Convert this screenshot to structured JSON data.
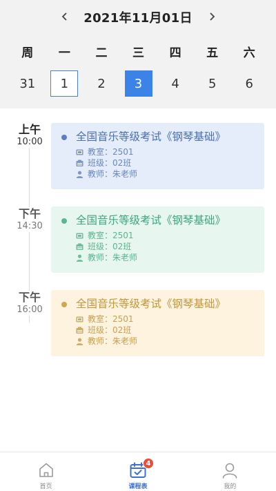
{
  "calendar": {
    "title": "2021年11月01日",
    "weekdays": [
      "周",
      "一",
      "二",
      "三",
      "四",
      "五",
      "六"
    ],
    "dates": [
      "31",
      "1",
      "2",
      "3",
      "4",
      "5",
      "6"
    ],
    "today_index": 1,
    "selected_index": 3
  },
  "schedule": [
    {
      "period": "上午",
      "time": "10:00",
      "title": "全国音乐等级考试《钢琴基础》",
      "room": "教室：2501",
      "class": "班级：02班",
      "teacher": "教师：朱老师",
      "color": "#e5edfb"
    },
    {
      "period": "下午",
      "time": "14:30",
      "title": "全国音乐等级考试《钢琴基础》",
      "room": "教室：2501",
      "class": "班级：02班",
      "teacher": "教师：朱老师",
      "color": "#e7f7f0"
    },
    {
      "period": "下午",
      "time": "16:00",
      "title": "全国音乐等级考试《钢琴基础》",
      "room": "教室：2501",
      "class": "班级：02班",
      "teacher": "教师：朱老师",
      "color": "#fdf3df"
    }
  ],
  "tabbar": {
    "home": "首页",
    "timetable": "课程表",
    "timetable_badge": "4",
    "mine": "我的"
  },
  "colors": {
    "accent": "#3c83e8",
    "badge": "#f04a38"
  }
}
